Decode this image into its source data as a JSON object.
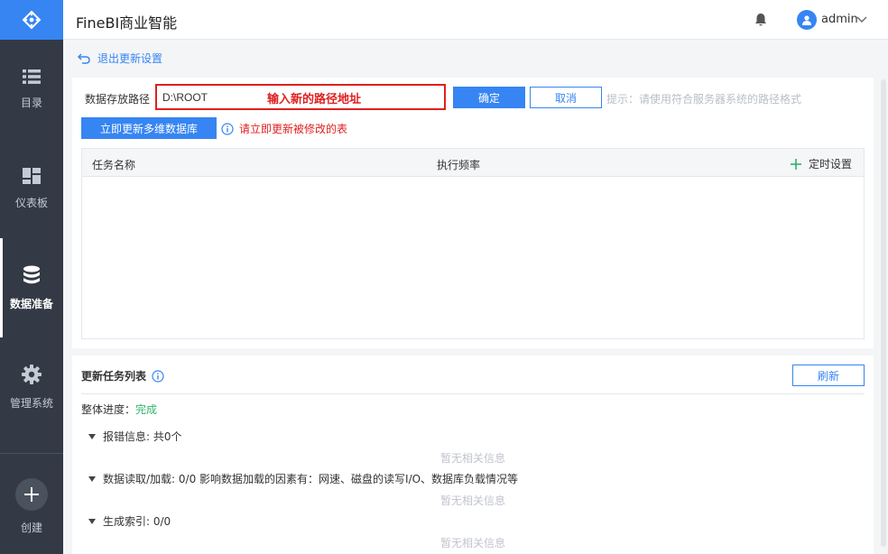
{
  "header": {
    "app_title": "FineBI商业智能",
    "username": "admin"
  },
  "sidebar": {
    "items": [
      {
        "label": "目录",
        "icon": "list-icon"
      },
      {
        "label": "仪表板",
        "icon": "dashboard-icon"
      },
      {
        "label": "数据准备",
        "icon": "database-icon",
        "active": true
      },
      {
        "label": "管理系统",
        "icon": "gear-icon"
      }
    ],
    "create_label": "创建"
  },
  "page": {
    "back_label": "退出更新设置"
  },
  "path_settings": {
    "label": "数据存放路径",
    "value": "D:\\ROOT",
    "annotation": "输入新的路径地址",
    "confirm_label": "确定",
    "cancel_label": "取消",
    "hint": "提示：请使用符合服务器系统的路径格式"
  },
  "update_now": {
    "button_label": "立即更新多维数据库",
    "warning": "请立即更新被修改的表"
  },
  "task_table": {
    "columns": [
      "任务名称",
      "执行频率"
    ],
    "schedule_label": "定时设置"
  },
  "update_list": {
    "title": "更新任务列表",
    "refresh_label": "刷新",
    "progress_label": "整体进度：",
    "progress_value": "完成",
    "sections": [
      {
        "label": "报错信息: 共0个",
        "empty": "暂无相关信息"
      },
      {
        "label": "数据读取/加载: 0/0 影响数据加载的因素有：网速、磁盘的读写I/O、数据库负载情况等",
        "empty": "暂无相关信息"
      },
      {
        "label": "生成索引: 0/0",
        "empty": "暂无相关信息"
      }
    ]
  },
  "colors": {
    "accent": "#3685f2",
    "sidebar_bg": "#333a45",
    "warning_red": "#e02020",
    "success_green": "#2fb36b"
  }
}
